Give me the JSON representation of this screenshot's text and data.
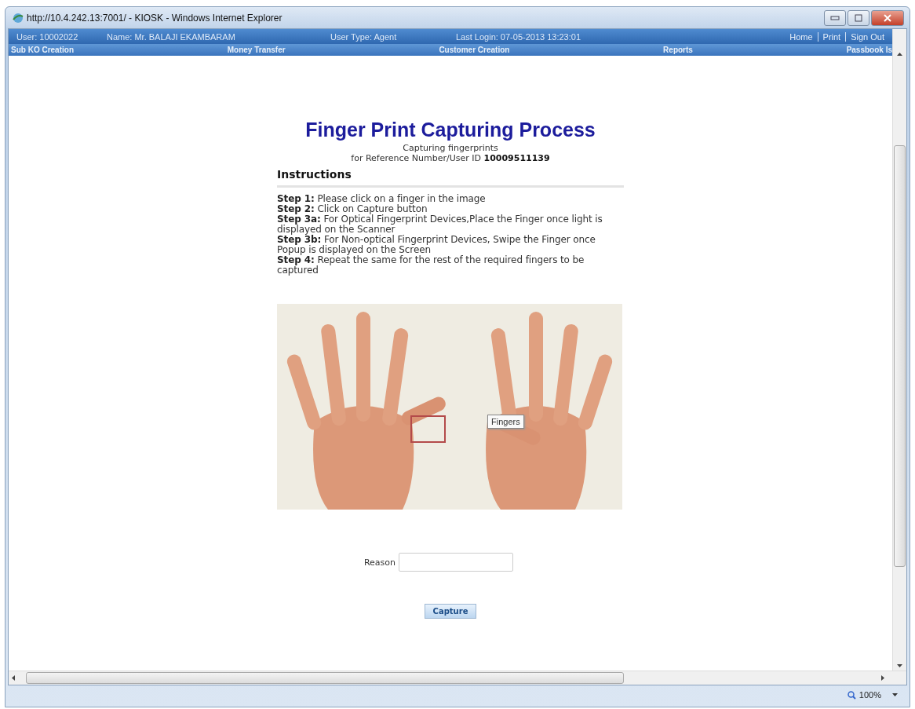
{
  "window": {
    "title": "http://10.4.242.13:7001/ - KIOSK - Windows Internet Explorer"
  },
  "header": {
    "user_info": [
      "User: 10002022",
      "Name: Mr.  BALAJI EKAMBARAM",
      "User Type: Agent",
      "Last Login: 07-05-2013 13:23:01"
    ],
    "links": [
      "Home",
      "Print",
      "Sign Out"
    ]
  },
  "nav": [
    "Sub KO Creation",
    "Money Transfer",
    "Customer Creation",
    "Reports",
    "Passbook Is"
  ],
  "page": {
    "title": "Finger Print Capturing Process",
    "subtitle": "Capturing fingerprints",
    "reference": "for Reference Number/User ID **10009511139**",
    "instructions_heading": "Instructions",
    "steps": [
      "**Step 1:** Please click on a finger in the image",
      "**Step 2:** Click on Capture button",
      "**Step 3a:** For Optical Fingerprint Devices,Place the Finger once light is displayed on the Scanner",
      "**Step 3b:** For Non-optical Fingerprint Devices, Swipe the Finger once Popup is displayed on the Screen",
      "**Step 4:** Repeat the same for the rest of the required fingers to be captured"
    ],
    "hand_image": {
      "kind": "picture",
      "tooltip": "Fingers"
    },
    "reason": {
      "label": "Reason"
    },
    "capture_button": "Capture"
  },
  "status_bar": {
    "zoom": "100%"
  }
}
